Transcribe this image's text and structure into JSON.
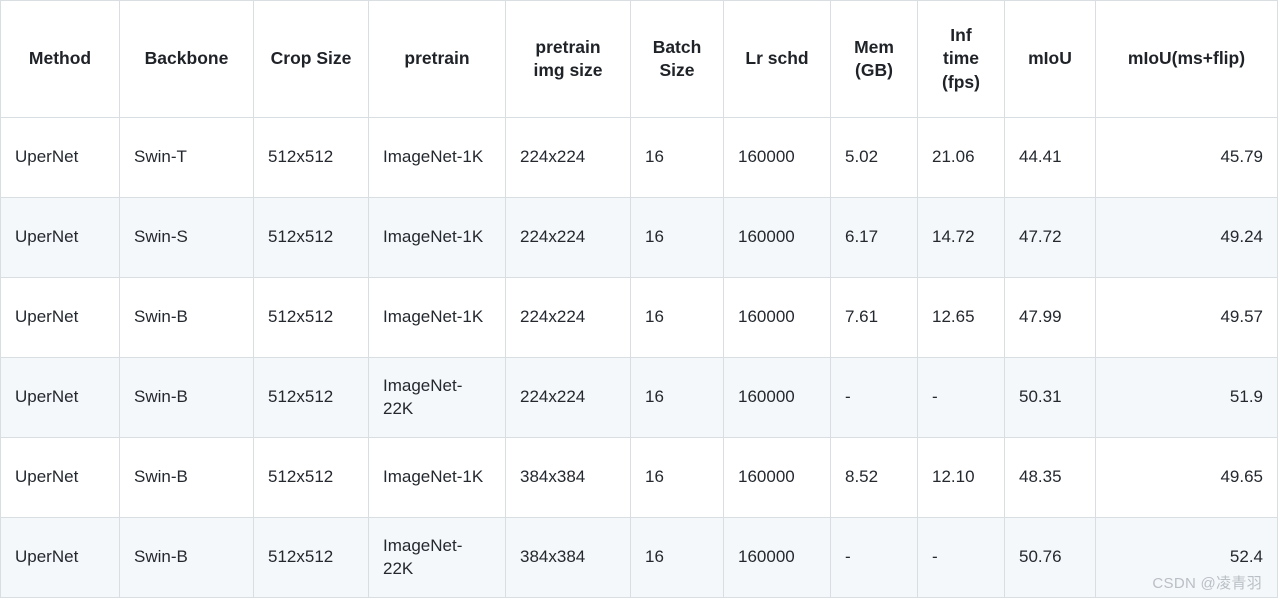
{
  "table": {
    "name": "swin-transformer-ade20k-semantic-segmentation-results",
    "columns": [
      {
        "key": "method",
        "label": "Method",
        "align": "left"
      },
      {
        "key": "backbone",
        "label": "Backbone",
        "align": "left"
      },
      {
        "key": "crop_size",
        "label": "Crop Size",
        "align": "left"
      },
      {
        "key": "pretrain",
        "label": "pretrain",
        "align": "left"
      },
      {
        "key": "pretrain_img_size",
        "label": "pretrain img size",
        "align": "left"
      },
      {
        "key": "batch_size",
        "label": "Batch Size",
        "align": "left"
      },
      {
        "key": "lr_schd",
        "label": "Lr schd",
        "align": "left"
      },
      {
        "key": "mem_gb",
        "label": "Mem (GB)",
        "align": "left"
      },
      {
        "key": "inf_time_fps",
        "label": "Inf time (fps)",
        "align": "left"
      },
      {
        "key": "miou",
        "label": "mIoU",
        "align": "left"
      },
      {
        "key": "miou_ms_flip",
        "label": "mIoU(ms+flip)",
        "align": "right"
      }
    ],
    "rows": [
      {
        "method": "UperNet",
        "backbone": "Swin-T",
        "crop_size": "512x512",
        "pretrain": "ImageNet-1K",
        "pretrain_img_size": "224x224",
        "batch_size": "16",
        "lr_schd": "160000",
        "mem_gb": "5.02",
        "inf_time_fps": "21.06",
        "miou": "44.41",
        "miou_ms_flip": "45.79"
      },
      {
        "method": "UperNet",
        "backbone": "Swin-S",
        "crop_size": "512x512",
        "pretrain": "ImageNet-1K",
        "pretrain_img_size": "224x224",
        "batch_size": "16",
        "lr_schd": "160000",
        "mem_gb": "6.17",
        "inf_time_fps": "14.72",
        "miou": "47.72",
        "miou_ms_flip": "49.24"
      },
      {
        "method": "UperNet",
        "backbone": "Swin-B",
        "crop_size": "512x512",
        "pretrain": "ImageNet-1K",
        "pretrain_img_size": "224x224",
        "batch_size": "16",
        "lr_schd": "160000",
        "mem_gb": "7.61",
        "inf_time_fps": "12.65",
        "miou": "47.99",
        "miou_ms_flip": "49.57"
      },
      {
        "method": "UperNet",
        "backbone": "Swin-B",
        "crop_size": "512x512",
        "pretrain": "ImageNet-22K",
        "pretrain_img_size": "224x224",
        "batch_size": "16",
        "lr_schd": "160000",
        "mem_gb": "-",
        "inf_time_fps": "-",
        "miou": "50.31",
        "miou_ms_flip": "51.9"
      },
      {
        "method": "UperNet",
        "backbone": "Swin-B",
        "crop_size": "512x512",
        "pretrain": "ImageNet-1K",
        "pretrain_img_size": "384x384",
        "batch_size": "16",
        "lr_schd": "160000",
        "mem_gb": "8.52",
        "inf_time_fps": "12.10",
        "miou": "48.35",
        "miou_ms_flip": "49.65"
      },
      {
        "method": "UperNet",
        "backbone": "Swin-B",
        "crop_size": "512x512",
        "pretrain": "ImageNet-22K",
        "pretrain_img_size": "384x384",
        "batch_size": "16",
        "lr_schd": "160000",
        "mem_gb": "-",
        "inf_time_fps": "-",
        "miou": "50.76",
        "miou_ms_flip": "52.4"
      }
    ]
  },
  "watermark": {
    "text": "CSDN @凌青羽"
  },
  "colors": {
    "border": "#d9dee3",
    "stripe": "#f5f8fa",
    "text": "#24292f",
    "watermark": "#b9bfc6"
  }
}
